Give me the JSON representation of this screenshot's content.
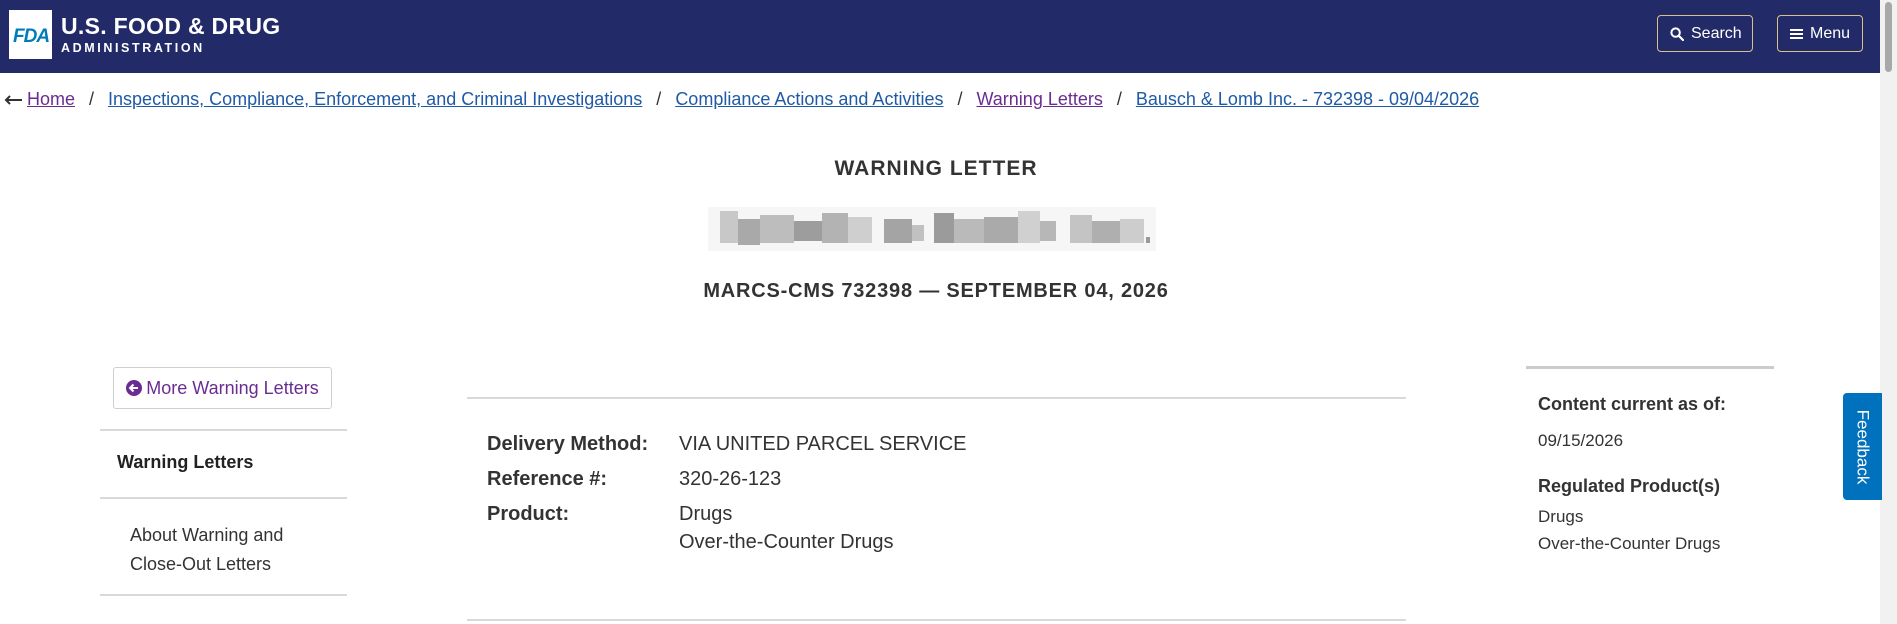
{
  "header": {
    "logo_text": "FDA",
    "agency_line1": "U.S. FOOD & DRUG",
    "agency_line2": "ADMINISTRATION",
    "search_label": "Search",
    "menu_label": "Menu",
    "background_color": "#222b68",
    "button_border_color": "#d8c188"
  },
  "breadcrumb": {
    "items": [
      {
        "label": "Home"
      },
      {
        "label": "Inspections, Compliance, Enforcement, and Criminal Investigations"
      },
      {
        "label": "Compliance Actions and Activities"
      },
      {
        "label": "Warning Letters"
      },
      {
        "label": "Bausch & Lomb Inc. - 732398 - 09/04/2026"
      }
    ],
    "separator": "/"
  },
  "letter": {
    "heading": "WARNING LETTER",
    "recipient_redacted": true,
    "marcs_line": "MARCS-CMS 732398 — SEPTEMBER 04, 2026"
  },
  "sidebar": {
    "more_button_label": "More Warning Letters",
    "active_item": "Warning Letters",
    "link_item": "About Warning and Close-Out Letters"
  },
  "details": {
    "delivery_label": "Delivery Method:",
    "delivery_value": "VIA UNITED PARCEL SERVICE",
    "reference_label": "Reference #:",
    "reference_value": "320-26-123",
    "product_label": "Product:",
    "product_values": [
      "Drugs",
      "Over-the-Counter Drugs"
    ]
  },
  "meta": {
    "content_current_label": "Content current as of:",
    "content_current_value": "09/15/2026",
    "regulated_label": "Regulated Product(s)",
    "regulated_values": [
      "Drugs",
      "Over-the-Counter Drugs"
    ]
  },
  "feedback_label": "Feedback",
  "colors": {
    "link": "#1f5aa6",
    "visited_link": "#6b2c91",
    "feedback_tab": "#0071bc"
  }
}
